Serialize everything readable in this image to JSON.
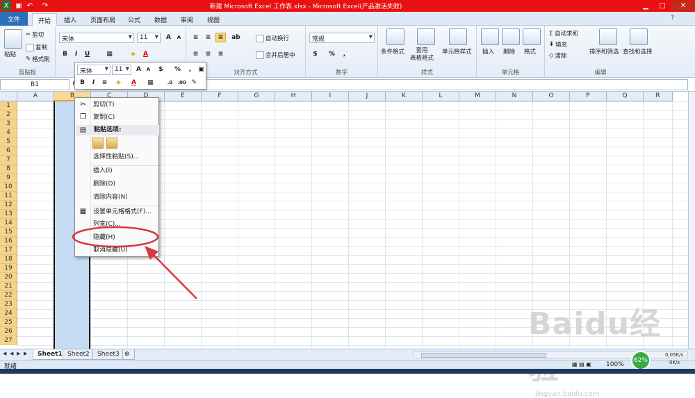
{
  "window": {
    "title": "新建 Microsoft Excel 工作表.xlsx  -  Microsoft Excel(产品激活失败)",
    "min": "▁",
    "max": "□",
    "close": "✕"
  },
  "tabs": {
    "file": "文件",
    "items": [
      "开始",
      "插入",
      "页面布局",
      "公式",
      "数据",
      "审阅",
      "视图"
    ]
  },
  "ribbon": {
    "clipboard": {
      "label": "剪贴板",
      "paste": "粘贴",
      "cut": "剪切",
      "copy": "复制",
      "painter": "格式刷"
    },
    "font": {
      "label": "字体",
      "name": "宋体",
      "size": "11",
      "bold": "B",
      "italic": "I",
      "underline": "U"
    },
    "alignment": {
      "label": "对齐方式",
      "wrap": "自动换行",
      "merge": "合并后居中"
    },
    "number": {
      "label": "数字",
      "format": "常规",
      "percent": "%",
      "comma": ","
    },
    "styles": {
      "label": "样式",
      "conditional": "条件格式",
      "table": "套用\n表格格式",
      "cell": "单元格样式"
    },
    "cells": {
      "label": "单元格",
      "insert": "插入",
      "delete": "删除",
      "format": "格式"
    },
    "editing": {
      "label": "编辑",
      "autosum": "Σ 自动求和",
      "fill": "填充",
      "clear": "清除",
      "sort": "排序和筛选",
      "find": "查找和选择"
    }
  },
  "formula_bar": {
    "namebox": "B1",
    "fx": "fx",
    "value": ""
  },
  "columns": [
    "A",
    "B",
    "C",
    "D",
    "E",
    "F",
    "G",
    "H",
    "I",
    "J",
    "K",
    "L",
    "M",
    "N",
    "O",
    "P",
    "Q",
    "R"
  ],
  "rows": [
    "1",
    "2",
    "3",
    "4",
    "5",
    "6",
    "7",
    "8",
    "9",
    "10",
    "11",
    "12",
    "13",
    "14",
    "15",
    "16",
    "17",
    "18",
    "19",
    "20",
    "21",
    "22",
    "23",
    "24",
    "25",
    "26",
    "27"
  ],
  "mini_toolbar": {
    "font": "宋体",
    "size": "11",
    "percent": "%",
    "comma": ",",
    "bold": "B",
    "italic": "I"
  },
  "context_menu": {
    "cut": "剪切(T)",
    "copy": "复制(C)",
    "paste_options": "粘贴选项:",
    "paste_special": "选择性粘贴(S)...",
    "insert": "插入(I)",
    "delete": "删除(D)",
    "clear": "清除内容(N)",
    "format_cells": "设置单元格格式(F)...",
    "col_width": "列宽(C)...",
    "hide": "隐藏(H)",
    "unhide": "取消隐藏(U)"
  },
  "sheets": [
    "Sheet1",
    "Sheet2",
    "Sheet3"
  ],
  "status": {
    "ready": "就绪",
    "zoom": "100%",
    "net_pct": "62%",
    "up": "0.05K/s",
    "down": "0K/s"
  },
  "watermark": {
    "brand": "Baidu经验",
    "url": "jingyan.baidu.com"
  },
  "colors": {
    "titlebar": "#e81010",
    "highlight": "#c6dcf5",
    "annotation": "#d9363e"
  }
}
